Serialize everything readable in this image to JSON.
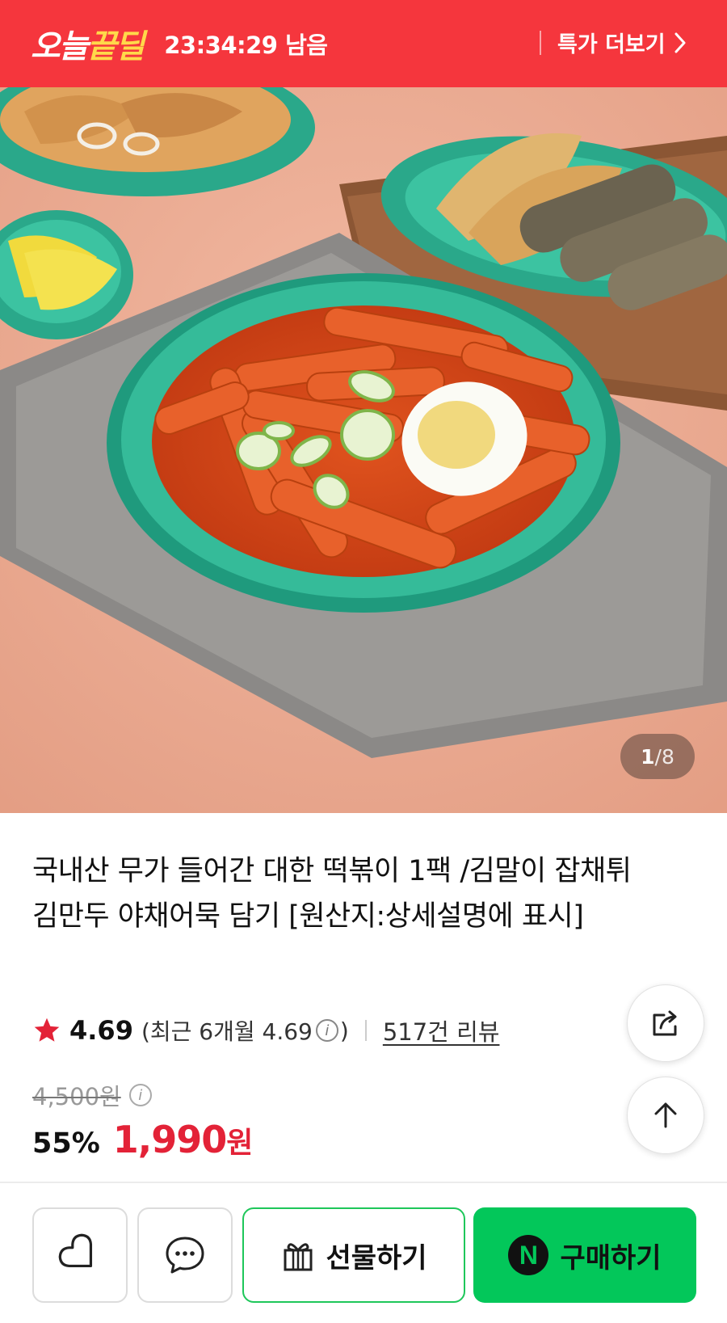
{
  "deal_banner": {
    "logo_part1": "오늘",
    "logo_part2": "끝딜",
    "timer": "23:34:29 남음",
    "more_label": "특가 더보기",
    "background_color": "#f5363d"
  },
  "gallery": {
    "current_index": "1",
    "total": "/8",
    "image_subject": "떡볶이"
  },
  "product": {
    "title": "국내산 무가 들어간 대한 떡볶이 1팩 /김말이 잡채튀김만두 야채어묵 담기 [원산지:상세설명에 표시]",
    "rating": {
      "score": "4.69",
      "recent_prefix": "(최근 6개월 4.69",
      "recent_suffix": ")",
      "info_icon": "i",
      "review_count": "517건 리뷰"
    },
    "price": {
      "original": "4,500원",
      "discount": "55%",
      "sale_amount": "1,990",
      "sale_unit": "원",
      "sale_color": "#e32237"
    }
  },
  "floating_buttons": {
    "share_icon": "share-icon",
    "top_icon": "arrow-up-icon"
  },
  "bottom_bar": {
    "wishlist_icon": "heart-icon",
    "chat_icon": "chat-bubble-icon",
    "gift_label": "선물하기",
    "buy_label": "구매하기",
    "buy_badge": "N",
    "buy_color": "#03c75a"
  }
}
